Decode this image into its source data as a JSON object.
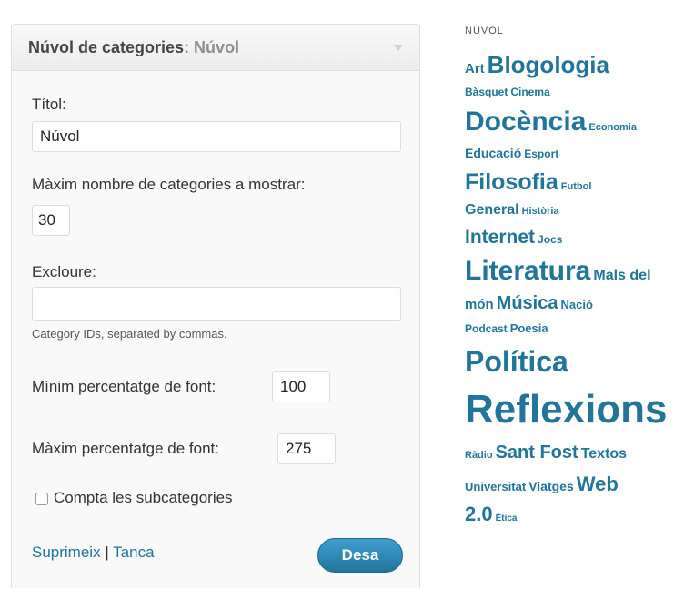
{
  "widget": {
    "title": "Núvol de categories",
    "title_suffix": ": Núvol",
    "title_field": {
      "label": "Títol:",
      "value": "Núvol"
    },
    "max_field": {
      "label": "Màxim nombre de categories a mostrar:",
      "value": "30"
    },
    "exclude_field": {
      "label": "Excloure:",
      "value": "",
      "hint": "Category IDs, separated by commas."
    },
    "min_font": {
      "label": "Mínim percentatge de font:",
      "value": "100"
    },
    "max_font": {
      "label": "Màxim percentatge de font:",
      "value": "275"
    },
    "subcategories": {
      "label": "Compta les subcategories",
      "checked": false
    },
    "delete_link": "Suprimeix",
    "separator": "|",
    "close_link": "Tanca",
    "save_button": "Desa"
  },
  "cloud": {
    "title": "NÚVOL",
    "rows": [
      [
        {
          "label": "Art",
          "size": 15
        },
        {
          "label": "Blogologia",
          "size": 26
        }
      ],
      [
        {
          "label": "Bàsquet",
          "size": 12
        },
        {
          "label": "Cinema",
          "size": 12
        }
      ],
      [
        {
          "label": "Docència",
          "size": 30
        },
        {
          "label": "Economia",
          "size": 11
        }
      ],
      [
        {
          "label": "Educació",
          "size": 14
        },
        {
          "label": "Esport",
          "size": 12
        }
      ],
      [
        {
          "label": "Filosofia",
          "size": 25
        },
        {
          "label": "Futbol",
          "size": 11
        }
      ],
      [
        {
          "label": "General",
          "size": 16
        },
        {
          "label": "Història",
          "size": 11
        }
      ],
      [
        {
          "label": "Internet",
          "size": 21
        },
        {
          "label": "Jocs",
          "size": 12
        }
      ],
      [
        {
          "label": "Literatura",
          "size": 30
        },
        {
          "label": "Mals del",
          "size": 16
        }
      ],
      [
        {
          "label": "món",
          "size": 15
        },
        {
          "label": "Música",
          "size": 20
        },
        {
          "label": "Nació",
          "size": 13
        }
      ],
      [
        {
          "label": "Podcast",
          "size": 12
        },
        {
          "label": "Poesia",
          "size": 13
        }
      ],
      [
        {
          "label": "Política",
          "size": 32
        }
      ],
      [
        {
          "label": "Reflexions",
          "size": 44
        }
      ],
      [
        {
          "label": "Ràdio",
          "size": 11
        },
        {
          "label": "Sant Fost",
          "size": 20
        },
        {
          "label": "Textos",
          "size": 16
        }
      ],
      [
        {
          "label": "Universitat",
          "size": 13
        },
        {
          "label": "Viatges",
          "size": 14
        },
        {
          "label": "Web",
          "size": 22
        }
      ],
      [
        {
          "label": "2.0",
          "size": 22
        },
        {
          "label": "Ètica",
          "size": 10
        }
      ]
    ]
  },
  "colors": {
    "link": "#21759b",
    "button": "#2a8bc0"
  }
}
